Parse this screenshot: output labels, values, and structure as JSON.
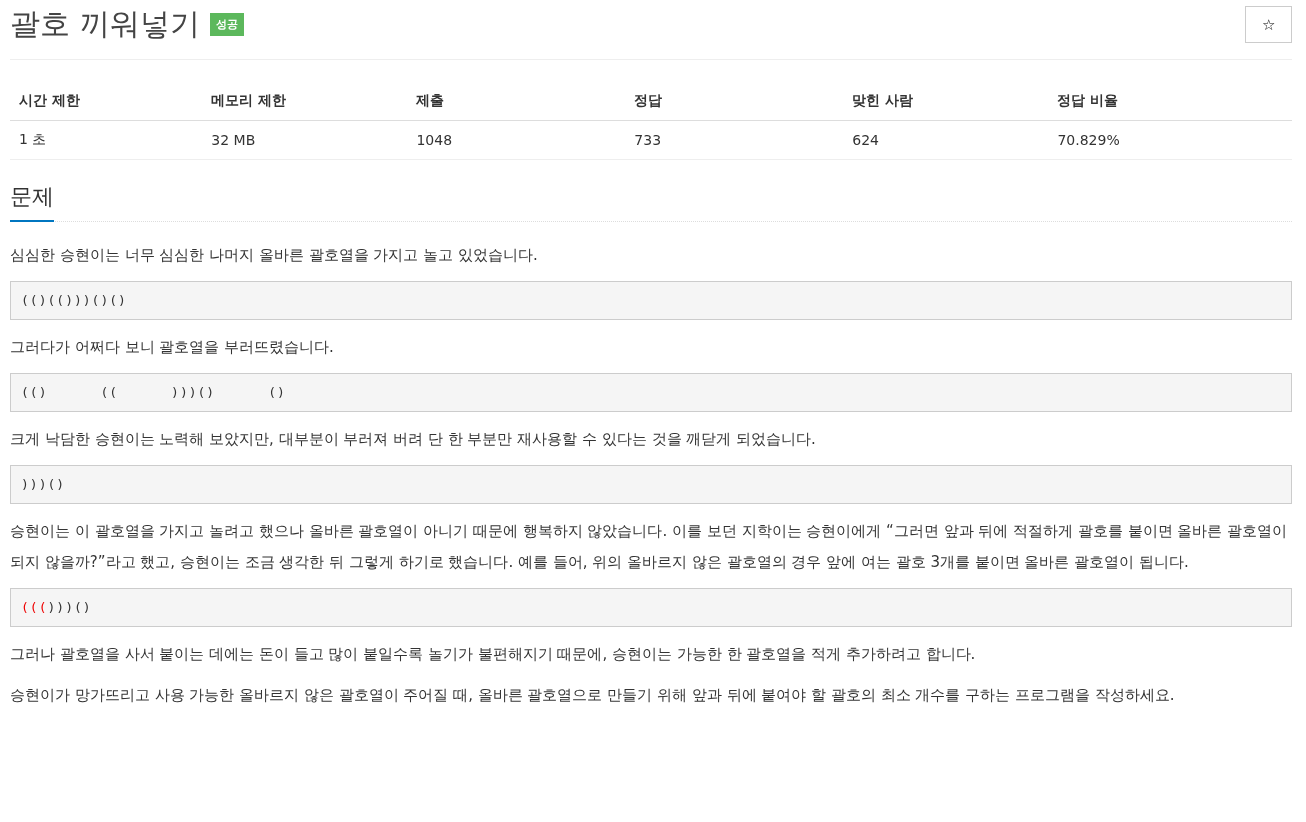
{
  "title": "괄호 끼워넣기",
  "badge": "성공",
  "star_button": "☆",
  "info_table": {
    "columns": [
      "시간 제한",
      "메모리 제한",
      "제출",
      "정답",
      "맞힌 사람",
      "정답 비율"
    ],
    "rows": [
      [
        "1 초",
        "32 MB",
        "1048",
        "733",
        "624",
        "70.829%"
      ]
    ]
  },
  "section_title": "문제",
  "content": [
    {
      "kind": "text",
      "text": "심심한 승현이는 너무 심심한 나머지 올바른 괄호열을 가지고 놀고 있었습니다."
    },
    {
      "kind": "code",
      "segments": [
        {
          "text": "(()(()))()()",
          "highlighted": false
        }
      ]
    },
    {
      "kind": "text",
      "text": "그러다가 어쩌다 보니 괄호열을 부러뜨렸습니다."
    },
    {
      "kind": "code",
      "segments": [
        {
          "text": "(()      ((      )))()      ()",
          "highlighted": false
        }
      ]
    },
    {
      "kind": "text",
      "text": "크게 낙담한 승현이는 노력해 보았지만, 대부분이 부러져 버려 단 한 부분만 재사용할 수 있다는 것을 깨닫게 되었습니다."
    },
    {
      "kind": "code",
      "segments": [
        {
          "text": ")))()",
          "highlighted": false
        }
      ]
    },
    {
      "kind": "text",
      "text": "승현이는 이 괄호열을 가지고 놀려고 했으나 올바른 괄호열이 아니기 때문에 행복하지 않았습니다. 이를 보던 지학이는 승현이에게 “그러면 앞과 뒤에 적절하게 괄호를 붙이면 올바른 괄호열이 되지 않을까?”라고 했고, 승현이는 조금 생각한 뒤 그렇게 하기로 했습니다. 예를 들어, 위의 올바르지 않은 괄호열의 경우 앞에 여는 괄호 3개를 붙이면 올바른 괄호열이 됩니다."
    },
    {
      "kind": "code",
      "segments": [
        {
          "text": "(((",
          "highlighted": true
        },
        {
          "text": ")))()",
          "highlighted": false
        }
      ]
    },
    {
      "kind": "text",
      "text": "그러나 괄호열을 사서 붙이는 데에는 돈이 들고 많이 붙일수록 놀기가 불편해지기 때문에, 승현이는 가능한 한 괄호열을 적게 추가하려고 합니다."
    },
    {
      "kind": "text",
      "text": "승현이가 망가뜨리고 사용 가능한 올바르지 않은 괄호열이 주어질 때, 올바른 괄호열으로 만들기 위해 앞과 뒤에 붙여야 할 괄호의 최소 개수를 구하는 프로그램을 작성하세요."
    }
  ]
}
